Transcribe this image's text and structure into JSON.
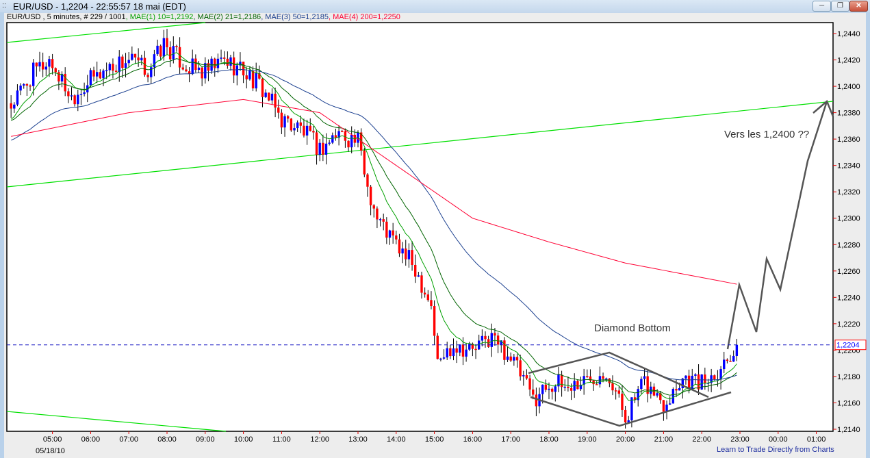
{
  "window": {
    "title": "EUR/USD - 1,2204 - 22:55:57  18 mai (EDT)",
    "grip_icon": "grip-dots-icon",
    "buttons": {
      "minimize": "minimize-icon",
      "restore": "restore-icon",
      "close": "close-icon"
    }
  },
  "infobar": {
    "symbol": "EUR/USD , 5 minutes, # 229 / 1001",
    "mae1": ", MAE(1) 10=1,2192",
    "mae2": ", MAE(2) 21=1,2186",
    "mae3": ", MAE(3) 50=1,2185",
    "mae4": ", MAE(4) 200=1,2250"
  },
  "footer_link": "Learn to Trade Directly from Charts",
  "chart_data": {
    "type": "candlestick",
    "interval": "5 minutes",
    "date_label": "05/18/10",
    "first_bar_time": "03:55",
    "last_bar_time": "22:55",
    "bar_count": 229,
    "last_price": "1,2204",
    "ylim": [
      1.214,
      1.245
    ],
    "y_ticks": [
      "1,2440",
      "1,2420",
      "1,2400",
      "1,2380",
      "1,2360",
      "1,2340",
      "1,2320",
      "1,2300",
      "1,2280",
      "1,2260",
      "1,2240",
      "1,2220",
      "1,2200",
      "1,2180",
      "1,2160",
      "1,2140"
    ],
    "x_ticks": [
      "05:00",
      "06:00",
      "07:00",
      "08:00",
      "09:00",
      "10:00",
      "11:00",
      "12:00",
      "13:00",
      "14:00",
      "15:00",
      "16:00",
      "17:00",
      "18:00",
      "19:00",
      "20:00",
      "21:00",
      "22:00",
      "23:00",
      "00:00",
      "01:00"
    ],
    "close_path": [
      [
        "03:55",
        1.2385
      ],
      [
        "04:30",
        1.241
      ],
      [
        "04:55",
        1.242
      ],
      [
        "05:30",
        1.2392
      ],
      [
        "06:00",
        1.2405
      ],
      [
        "06:30",
        1.2415
      ],
      [
        "07:00",
        1.242
      ],
      [
        "07:30",
        1.2412
      ],
      [
        "07:55",
        1.2432
      ],
      [
        "08:30",
        1.2415
      ],
      [
        "09:00",
        1.241
      ],
      [
        "09:30",
        1.242
      ],
      [
        "10:00",
        1.2412
      ],
      [
        "10:30",
        1.2398
      ],
      [
        "11:00",
        1.2375
      ],
      [
        "11:30",
        1.2368
      ],
      [
        "12:00",
        1.2352
      ],
      [
        "12:30",
        1.2365
      ],
      [
        "13:00",
        1.2358
      ],
      [
        "13:15",
        1.2325
      ],
      [
        "13:30",
        1.23
      ],
      [
        "14:00",
        1.228
      ],
      [
        "14:30",
        1.2262
      ],
      [
        "14:55",
        1.2235
      ],
      [
        "15:05",
        1.219
      ],
      [
        "15:30",
        1.2205
      ],
      [
        "16:00",
        1.22
      ],
      [
        "16:30",
        1.221
      ],
      [
        "17:00",
        1.2195
      ],
      [
        "17:35",
        1.2163
      ],
      [
        "18:00",
        1.2175
      ],
      [
        "18:30",
        1.2172
      ],
      [
        "19:00",
        1.2178
      ],
      [
        "19:30",
        1.2186
      ],
      [
        "20:00",
        1.215
      ],
      [
        "20:30",
        1.2175
      ],
      [
        "21:00",
        1.216
      ],
      [
        "21:30",
        1.218
      ],
      [
        "22:00",
        1.2175
      ],
      [
        "22:30",
        1.2188
      ],
      [
        "22:55",
        1.2204
      ]
    ],
    "series": [
      {
        "name": "MAE(1) 10",
        "color": "#00a000",
        "period": 10
      },
      {
        "name": "MAE(2) 21",
        "color": "#006400",
        "period": 21
      },
      {
        "name": "MAE(3) 50",
        "color": "#1a3f8f",
        "period": 50
      },
      {
        "name": "MAE(4) 200",
        "color": "#ff0033",
        "path": [
          [
            "03:55",
            1.2362
          ],
          [
            "07:00",
            1.238
          ],
          [
            "10:00",
            1.239
          ],
          [
            "12:00",
            1.238
          ],
          [
            "14:00",
            1.234
          ],
          [
            "16:00",
            1.23
          ],
          [
            "18:00",
            1.2282
          ],
          [
            "20:00",
            1.2266
          ],
          [
            "22:55",
            1.225
          ]
        ]
      }
    ],
    "colors": {
      "up": "#0000ff",
      "down": "#ff0000",
      "trendline": "#00e000",
      "annotation": "#555555"
    },
    "annotations": {
      "diamond": "Diamond Bottom",
      "target": "Vers les 1,2400 ??"
    }
  }
}
